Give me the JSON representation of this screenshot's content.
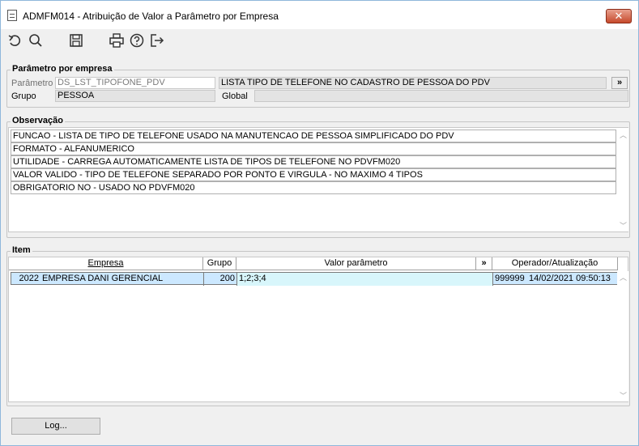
{
  "window": {
    "title": "ADMFM014 - Atribuição de Valor a Parâmetro por Empresa",
    "close_label": "✕"
  },
  "toolbar": {
    "buttons": [
      {
        "name": "refresh",
        "icon": "undo-icon"
      },
      {
        "name": "search",
        "icon": "search-icon"
      },
      {
        "name": "save",
        "icon": "save-icon"
      },
      {
        "name": "print",
        "icon": "printer-icon"
      },
      {
        "name": "help",
        "icon": "help-icon"
      },
      {
        "name": "exit",
        "icon": "exit-icon"
      }
    ]
  },
  "parametro": {
    "section_label": "Parâmetro por empresa",
    "parametro_label": "Parâmetro",
    "parametro_value": "DS_LST_TIPOFONE_PDV",
    "descricao_value": "LISTA TIPO DE TELEFONE NO CADASTRO DE PESSOA DO PDV",
    "expand_label": "»",
    "grupo_label": "Grupo",
    "grupo_value": "PESSOA",
    "global_label": "Global",
    "global_value": ""
  },
  "observacao": {
    "section_label": "Observação",
    "lines": [
      "FUNCAO - LISTA DE TIPO DE TELEFONE USADO NA MANUTENCAO DE PESSOA SIMPLIFICADO DO PDV",
      "FORMATO - ALFANUMERICO",
      "UTILIDADE - CARREGA AUTOMATICAMENTE LISTA DE TIPOS DE TELEFONE NO PDVFM020",
      "VALOR VALIDO - TIPO DE TELEFONE SEPARADO POR PONTO E VIRGULA - NO MAXIMO 4 TIPOS",
      "OBRIGATORIO NO - USADO NO PDVFM020"
    ]
  },
  "item": {
    "section_label": "Item",
    "columns": {
      "empresa": "Empresa",
      "grupo": "Grupo",
      "valor": "Valor parâmetro",
      "expand": "»",
      "operador": "Operador/Atualização"
    },
    "rows": [
      {
        "empresa_cod": "2022",
        "empresa_nome": "EMPRESA DANI GERENCIAL",
        "grupo": "200",
        "valor": "1;2;3;4",
        "operador": "999999",
        "atualizacao": "14/02/2021 09:50:13"
      }
    ]
  },
  "footer": {
    "log_label": "Log..."
  },
  "colors": {
    "selected_row": "#cce8ff",
    "window_bg": "#f0f0f0",
    "close_button": "#c74a2c"
  }
}
